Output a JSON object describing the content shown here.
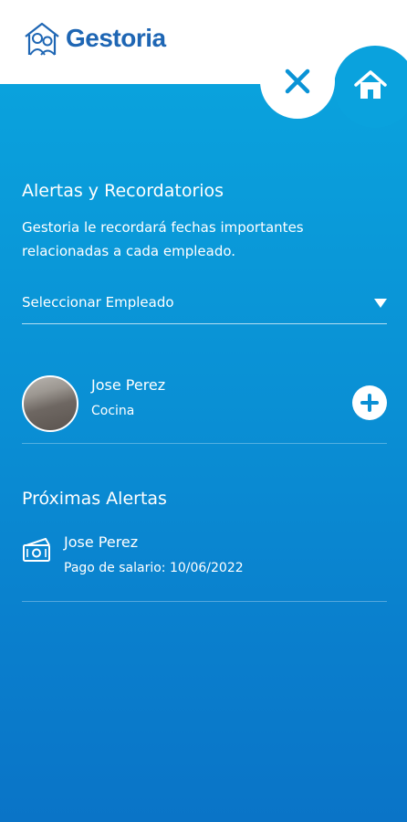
{
  "header": {
    "logo_text": "Gestoria"
  },
  "alerts_page": {
    "title": "Alertas y Recordatorios",
    "description": "Gestoria le recordará fechas importantes relacionadas a cada empleado.",
    "employee_select": {
      "selected_label": "Seleccionar Empleado"
    }
  },
  "employee": {
    "name": "Jose Perez",
    "role": "Cocina"
  },
  "upcoming": {
    "title": "Próximas Alertas",
    "items": [
      {
        "name": "Jose Perez",
        "detail": "Pago de salario: 10/06/2022",
        "icon": "money-icon"
      }
    ]
  },
  "colors": {
    "brand": "#1e66b4",
    "panel_top": "#0aa2dd",
    "panel_bottom": "#0a74c7"
  },
  "icons": [
    "logo-icon",
    "close-icon",
    "home-icon",
    "chevron-down-icon",
    "plus-icon",
    "money-icon"
  ]
}
